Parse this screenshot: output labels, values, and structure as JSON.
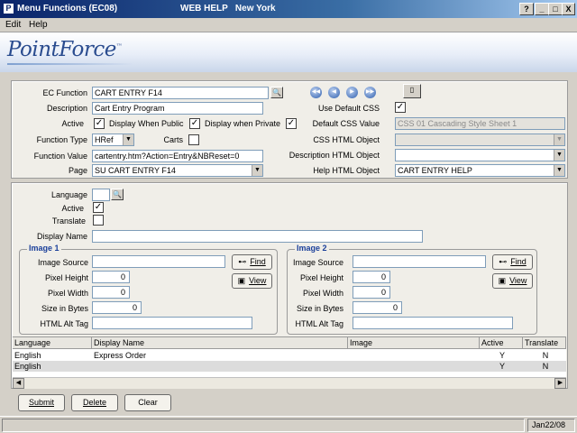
{
  "window": {
    "title": "Menu Functions (EC08)",
    "center_text": "WEB HELP   New York",
    "help_btn": "?",
    "min_btn": "_",
    "max_btn": "□",
    "close_btn": "X"
  },
  "menu": {
    "edit": "Edit",
    "help": "Help"
  },
  "banner": {
    "logo_main": "PointForce",
    "logo_tm": "™"
  },
  "form": {
    "ec_function_label": "EC Function",
    "ec_function_value": "CART ENTRY F14",
    "description_label": "Description",
    "description_value": "Cart Entry Program",
    "active_label": "Active",
    "display_when_public_label": "Display When Public",
    "display_when_private_label": "Display when Private",
    "function_type_label": "Function Type",
    "function_type_value": "HRef",
    "carts_label": "Carts",
    "function_value_label": "Function Value",
    "function_value_value": "cartentry.htm?Action=Entry&NBReset=0",
    "page_label": "Page",
    "page_value": "SU CART ENTRY F14",
    "use_default_css_label": "Use Default CSS",
    "default_css_value_label": "Default CSS Value",
    "default_css_value_value": "CSS 01 Cascading Style Sheet 1",
    "css_html_object_label": "CSS HTML Object",
    "css_html_object_value": "",
    "description_html_object_label": "Description HTML Object",
    "description_html_object_value": "",
    "help_html_object_label": "Help HTML Object",
    "help_html_object_value": "CART ENTRY HELP",
    "checks": {
      "active": true,
      "display_public": true,
      "display_private": true,
      "carts": false,
      "use_default_css": true
    }
  },
  "lang": {
    "language_label": "Language",
    "language_value": "",
    "active_label": "Active",
    "translate_label": "Translate",
    "display_name_label": "Display Name",
    "display_name_value": "",
    "checks": {
      "active": true,
      "translate": false
    }
  },
  "image1": {
    "legend": "Image 1",
    "source_label": "Image Source",
    "source_value": "",
    "height_label": "Pixel Height",
    "height_value": "0",
    "width_label": "Pixel Width",
    "width_value": "0",
    "size_label": "Size in Bytes",
    "size_value": "0",
    "alt_label": "HTML Alt Tag",
    "alt_value": "",
    "find_label": "Find",
    "view_label": "View"
  },
  "image2": {
    "legend": "Image 2",
    "source_label": "Image Source",
    "source_value": "",
    "height_label": "Pixel Height",
    "height_value": "0",
    "width_label": "Pixel Width",
    "width_value": "0",
    "size_label": "Size in Bytes",
    "size_value": "0",
    "alt_label": "HTML Alt Tag",
    "alt_value": "",
    "find_label": "Find",
    "view_label": "View"
  },
  "grid": {
    "columns": [
      "Language",
      "Display Name",
      "Image",
      "Active",
      "Translate"
    ],
    "rows": [
      [
        "English",
        "Express Order",
        "",
        "Y",
        "N"
      ],
      [
        "English",
        "",
        "",
        "Y",
        "N"
      ]
    ]
  },
  "buttons": {
    "submit": "Submit",
    "delete": "Delete",
    "clear": "Clear"
  },
  "status": {
    "date": "Jan22/08"
  },
  "icons": {
    "lookup": "magnifier-icon",
    "nav": [
      "first-icon",
      "prev-icon",
      "next-icon",
      "last-icon"
    ],
    "find": "binoculars-icon",
    "view": "picture-icon",
    "doc": "document-icon"
  },
  "colors": {
    "title_bar": "#0a246a",
    "group_legend": "#1a3f9a",
    "logo": "#2a4c8f",
    "row_selected": "#dcdcdc"
  }
}
